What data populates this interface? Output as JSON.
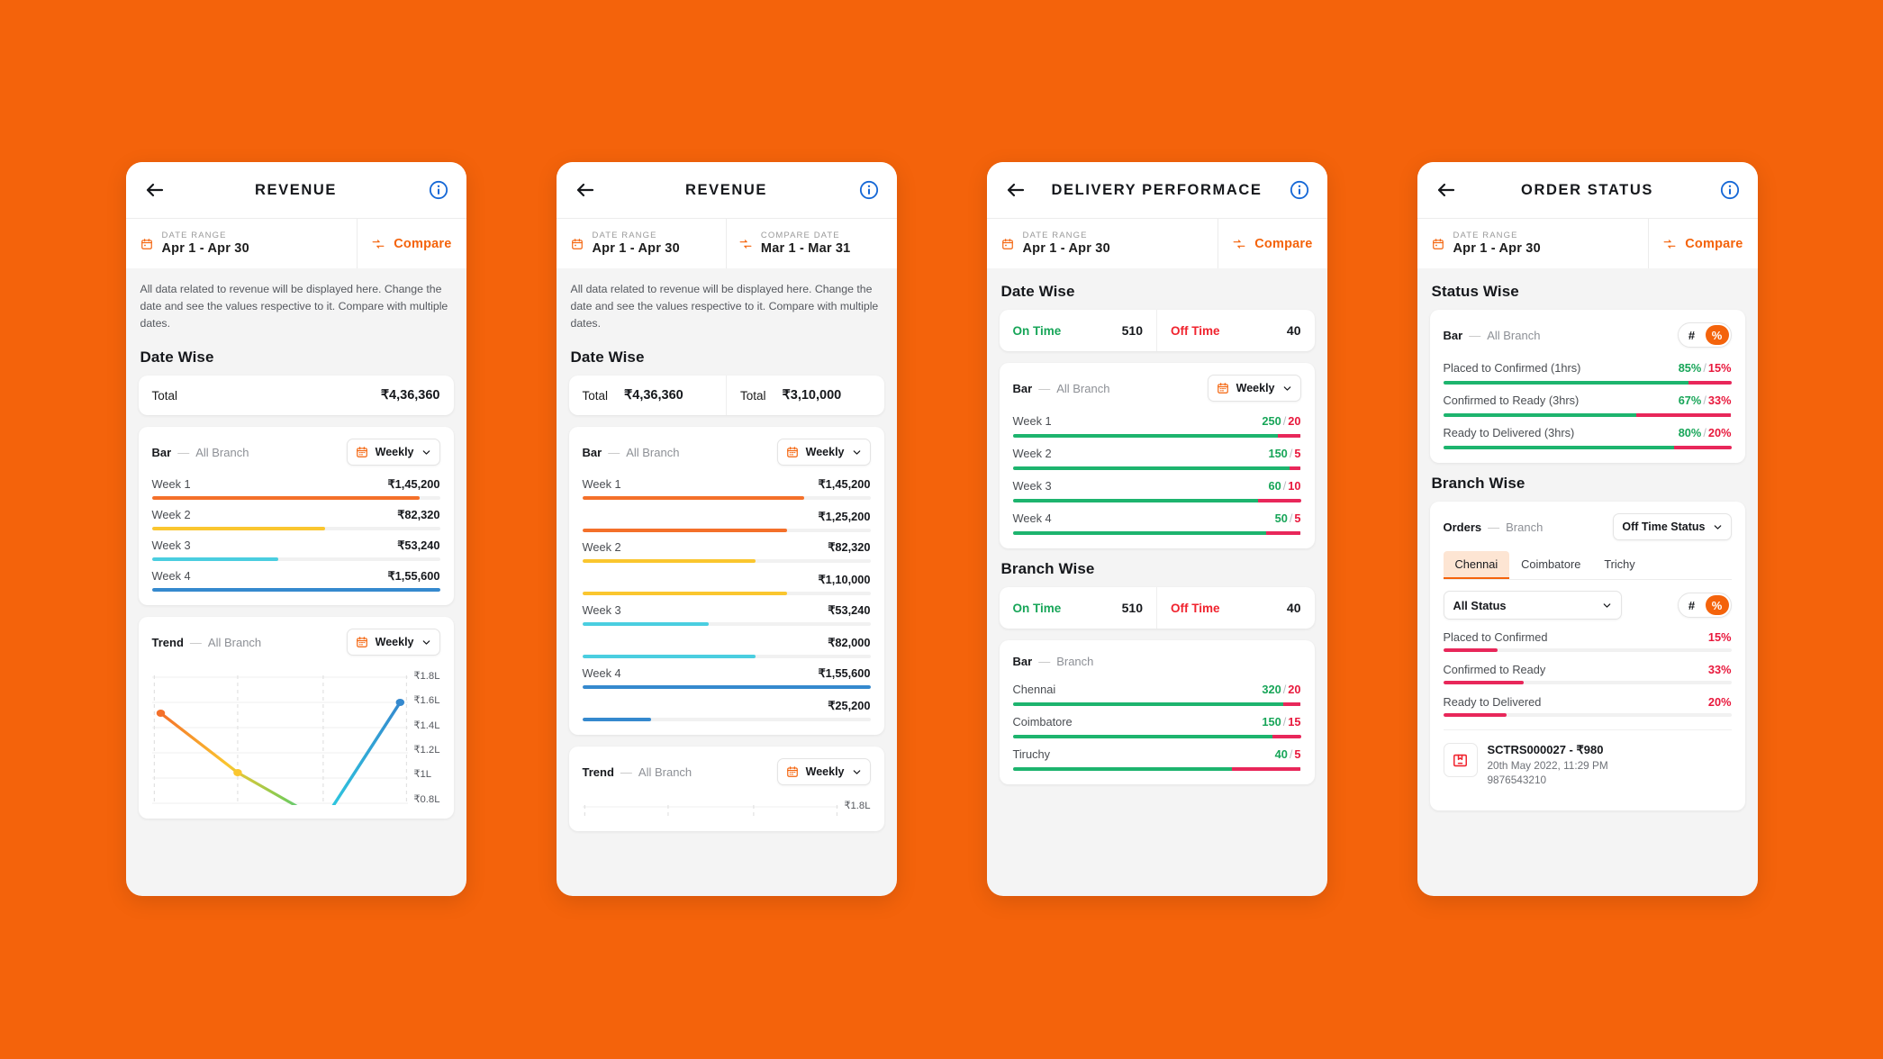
{
  "theme": {
    "brand": "#F4630B",
    "green": "#17A558",
    "red": "#E8183C",
    "page_bg": "#F4630B"
  },
  "phones": [
    {
      "id": "revenue-single",
      "title": "REVENUE",
      "date_range": {
        "label": "DATE RANGE",
        "value": "Apr 1 - Apr 30"
      },
      "compare": {
        "label": "Compare",
        "is_date": false
      },
      "description": "All data related to revenue will be displayed here. Change the date and see the values respective to it. Compare with multiple dates.",
      "section_title": "Date Wise",
      "totals": [
        {
          "label": "Total",
          "value": "₹4,36,360"
        }
      ],
      "bar_card": {
        "title": "Bar",
        "dash": "—",
        "scope": "All Branch",
        "period": "Weekly",
        "rows": [
          {
            "name": "Week 1",
            "value": "₹1,45,200",
            "pct": 93,
            "color": "#F4702A"
          },
          {
            "name": "Week 2",
            "value": "₹82,320",
            "pct": 60,
            "color": "#FAC62F"
          },
          {
            "name": "Week 3",
            "value": "₹53,240",
            "pct": 44,
            "color": "#4ACEE0"
          },
          {
            "name": "Week 4",
            "value": "₹1,55,600",
            "pct": 100,
            "color": "#3589CE"
          }
        ]
      },
      "trend_card": {
        "title": "Trend",
        "dash": "—",
        "scope": "All Branch",
        "period": "Weekly",
        "ylabels": [
          "₹1.8L",
          "₹1.6L",
          "₹1.4L",
          "₹1.2L",
          "₹1L",
          "₹0.8L"
        ]
      }
    },
    {
      "id": "revenue-compare",
      "title": "REVENUE",
      "date_range": {
        "label": "DATE RANGE",
        "value": "Apr 1 - Apr 30"
      },
      "compare": {
        "label": "COMPARE DATE",
        "value": "Mar 1 - Mar 31",
        "is_date": true
      },
      "description": "All data related to revenue will be displayed here. Change the date and see the values respective to it. Compare with multiple dates.",
      "section_title": "Date Wise",
      "totals": [
        {
          "label": "Total",
          "value": "₹4,36,360"
        },
        {
          "label": "Total",
          "value": "₹3,10,000"
        }
      ],
      "bar_card": {
        "title": "Bar",
        "dash": "—",
        "scope": "All Branch",
        "period": "Weekly",
        "rows": [
          {
            "name": "Week 1",
            "value": "₹1,45,200",
            "pct": 77,
            "color": "#F4702A",
            "compare": {
              "value": "₹1,25,200",
              "pct": 71,
              "color": "#F4702A"
            }
          },
          {
            "name": "Week 2",
            "value": "₹82,320",
            "pct": 60,
            "color": "#FAC62F",
            "compare": {
              "value": "₹1,10,000",
              "pct": 71,
              "color": "#FAC62F"
            }
          },
          {
            "name": "Week 3",
            "value": "₹53,240",
            "pct": 44,
            "color": "#4ACEE0",
            "compare": {
              "value": "₹82,000",
              "pct": 60,
              "color": "#4ACEE0"
            }
          },
          {
            "name": "Week 4",
            "value": "₹1,55,600",
            "pct": 100,
            "color": "#3589CE",
            "compare": {
              "value": "₹25,200",
              "pct": 24,
              "color": "#3589CE"
            }
          }
        ]
      },
      "trend_card": {
        "title": "Trend",
        "dash": "—",
        "scope": "All Branch",
        "period": "Weekly",
        "ylabels": [
          "₹1.8L"
        ]
      }
    },
    {
      "id": "delivery-performance",
      "title": "DELIVERY PERFORMACE",
      "date_range": {
        "label": "DATE RANGE",
        "value": "Apr 1 - Apr 30"
      },
      "compare": {
        "label": "Compare",
        "is_date": false
      },
      "section_title": "Date Wise",
      "split": {
        "on_label": "On Time",
        "on_value": "510",
        "off_label": "Off Time",
        "off_value": "40"
      },
      "bar_card": {
        "title": "Bar",
        "dash": "—",
        "scope": "All Branch",
        "period": "Weekly",
        "rows": [
          {
            "name": "Week 1",
            "on": "250",
            "off": "20",
            "sep": "/",
            "green_pct": 92,
            "red_pct": 8
          },
          {
            "name": "Week 2",
            "on": "150",
            "off": "5",
            "sep": "/",
            "green_pct": 96,
            "red_pct": 4
          },
          {
            "name": "Week 3",
            "on": "60",
            "off": "10",
            "sep": "/",
            "green_pct": 85,
            "red_pct": 15
          },
          {
            "name": "Week 4",
            "on": "50",
            "off": "5",
            "sep": "/",
            "green_pct": 88,
            "red_pct": 12
          }
        ]
      },
      "section_title_2": "Branch Wise",
      "split2": {
        "on_label": "On Time",
        "on_value": "510",
        "off_label": "Off Time",
        "off_value": "40"
      },
      "bar_card_2": {
        "title": "Bar",
        "dash": "—",
        "scope": "Branch",
        "rows": [
          {
            "name": "Chennai",
            "on": "320",
            "off": "20",
            "sep": "/",
            "green_pct": 94,
            "red_pct": 6
          },
          {
            "name": "Coimbatore",
            "on": "150",
            "off": "15",
            "sep": "/",
            "green_pct": 90,
            "red_pct": 10
          },
          {
            "name": "Tiruchy",
            "on": "40",
            "off": "5",
            "sep": "/",
            "green_pct": 76,
            "red_pct": 24
          }
        ]
      }
    },
    {
      "id": "order-status",
      "title": "ORDER STATUS",
      "date_range": {
        "label": "DATE RANGE",
        "value": "Apr 1 - Apr 30"
      },
      "compare": {
        "label": "Compare",
        "is_date": false
      },
      "section_title": "Status Wise",
      "status_card": {
        "title": "Bar",
        "dash": "—",
        "scope": "All Branch",
        "toggle": {
          "hash": "#",
          "percent": "%",
          "active": "percent"
        },
        "rows": [
          {
            "name": "Placed to Confirmed (1hrs)",
            "on": "85%",
            "off": "15%",
            "sep": "/",
            "green_pct": 85,
            "red_pct": 15
          },
          {
            "name": "Confirmed to Ready (3hrs)",
            "on": "67%",
            "off": "33%",
            "sep": "/",
            "green_pct": 67,
            "red_pct": 33
          },
          {
            "name": "Ready to Delivered (3hrs)",
            "on": "80%",
            "off": "20%",
            "sep": "/",
            "green_pct": 80,
            "red_pct": 20
          }
        ]
      },
      "section_title_2": "Branch Wise",
      "branch_card": {
        "title": "Orders",
        "dash": "—",
        "scope": "Branch",
        "status_filter": "Off Time Status",
        "tabs": [
          {
            "label": "Chennai",
            "active": true
          },
          {
            "label": "Coimbatore",
            "active": false
          },
          {
            "label": "Trichy",
            "active": false
          }
        ],
        "select": "All Status",
        "toggle": {
          "hash": "#",
          "percent": "%",
          "active": "percent"
        },
        "rows": [
          {
            "name": "Placed to Confirmed",
            "value": "15%",
            "pct": 19
          },
          {
            "name": "Confirmed to Ready",
            "value": "33%",
            "pct": 28
          },
          {
            "name": "Ready to Delivered",
            "value": "20%",
            "pct": 22
          }
        ],
        "order": {
          "line1": "SCTRS000027 - ₹980",
          "line2": "20th May 2022, 11:29 PM",
          "line3": "9876543210"
        }
      }
    }
  ],
  "chart_data": [
    {
      "type": "bar",
      "title": "Revenue — Date Wise (All Branch, Weekly)",
      "categories": [
        "Week 1",
        "Week 2",
        "Week 3",
        "Week 4"
      ],
      "values": [
        145200,
        82320,
        53240,
        155600
      ],
      "value_labels": [
        "₹1,45,200",
        "₹82,320",
        "₹53,240",
        "₹1,55,600"
      ],
      "total": 436360,
      "total_label": "₹4,36,360",
      "colors": [
        "#F4702A",
        "#FAC62F",
        "#4ACEE0",
        "#3589CE"
      ],
      "xlabel": "",
      "ylabel": "Revenue",
      "legend": "none",
      "grid": false
    },
    {
      "type": "bar",
      "title": "Revenue Compare — Date Wise (All Branch, Weekly)",
      "categories": [
        "Week 1",
        "Week 2",
        "Week 3",
        "Week 4"
      ],
      "series": [
        {
          "name": "Apr 1 - Apr 30",
          "values": [
            145200,
            82320,
            53240,
            155600
          ],
          "value_labels": [
            "₹1,45,200",
            "₹82,320",
            "₹53,240",
            "₹1,55,600"
          ],
          "total": 436360
        },
        {
          "name": "Mar 1 - Mar 31",
          "values": [
            125200,
            110000,
            82000,
            25200
          ],
          "value_labels": [
            "₹1,25,200",
            "₹1,10,000",
            "₹82,000",
            "₹25,200"
          ],
          "total": 310000
        }
      ],
      "colors": [
        "#F4702A",
        "#FAC62F",
        "#4ACEE0",
        "#3589CE"
      ],
      "grid": false
    },
    {
      "type": "line",
      "title": "Revenue Trend (All Branch, Weekly)",
      "x": [
        "Week 1",
        "Week 2",
        "Week 3",
        "Week 4"
      ],
      "series": [
        {
          "name": "Revenue",
          "values": [
            145000,
            82000,
            53000,
            156000
          ]
        }
      ],
      "ylim": [
        80000,
        180000
      ],
      "ytick_labels": [
        "₹1.8L",
        "₹1.6L",
        "₹1.4L",
        "₹1.2L",
        "₹1L",
        "₹0.8L"
      ],
      "ytick_values": [
        180000,
        160000,
        140000,
        120000,
        100000,
        80000
      ],
      "grid": true,
      "legend": "none"
    },
    {
      "type": "bar",
      "title": "Delivery Performance — Date Wise (All Branch, Weekly)",
      "categories": [
        "Week 1",
        "Week 2",
        "Week 3",
        "Week 4"
      ],
      "series": [
        {
          "name": "On Time",
          "values": [
            250,
            150,
            60,
            50
          ],
          "color": "#1DB46E"
        },
        {
          "name": "Off Time",
          "values": [
            20,
            5,
            10,
            5
          ],
          "color": "#E8275A"
        }
      ],
      "summary": {
        "On Time": 510,
        "Off Time": 40
      },
      "grid": false
    },
    {
      "type": "bar",
      "title": "Delivery Performance — Branch Wise",
      "categories": [
        "Chennai",
        "Coimbatore",
        "Tiruchy"
      ],
      "series": [
        {
          "name": "On Time",
          "values": [
            320,
            150,
            40
          ],
          "color": "#1DB46E"
        },
        {
          "name": "Off Time",
          "values": [
            20,
            15,
            5
          ],
          "color": "#E8275A"
        }
      ],
      "summary": {
        "On Time": 510,
        "Off Time": 40
      },
      "grid": false
    },
    {
      "type": "bar",
      "title": "Order Status — Status Wise (All Branch, %)",
      "categories": [
        "Placed to Confirmed (1hrs)",
        "Confirmed to Ready (3hrs)",
        "Ready to Delivered (3hrs)"
      ],
      "series": [
        {
          "name": "On Time %",
          "values": [
            85,
            67,
            80
          ],
          "color": "#1DB46E"
        },
        {
          "name": "Off Time %",
          "values": [
            15,
            33,
            20
          ],
          "color": "#E8275A"
        }
      ],
      "ylim": [
        0,
        100
      ],
      "grid": false
    },
    {
      "type": "bar",
      "title": "Order Status — Branch Wise: Chennai, Off Time Status (%)",
      "categories": [
        "Placed to Confirmed",
        "Confirmed to Ready",
        "Ready to Delivered"
      ],
      "values": [
        15,
        33,
        20
      ],
      "value_labels": [
        "15%",
        "33%",
        "20%"
      ],
      "colors": [
        "#E8275A",
        "#E8275A",
        "#E8275A"
      ],
      "ylim": [
        0,
        100
      ],
      "grid": false
    }
  ]
}
